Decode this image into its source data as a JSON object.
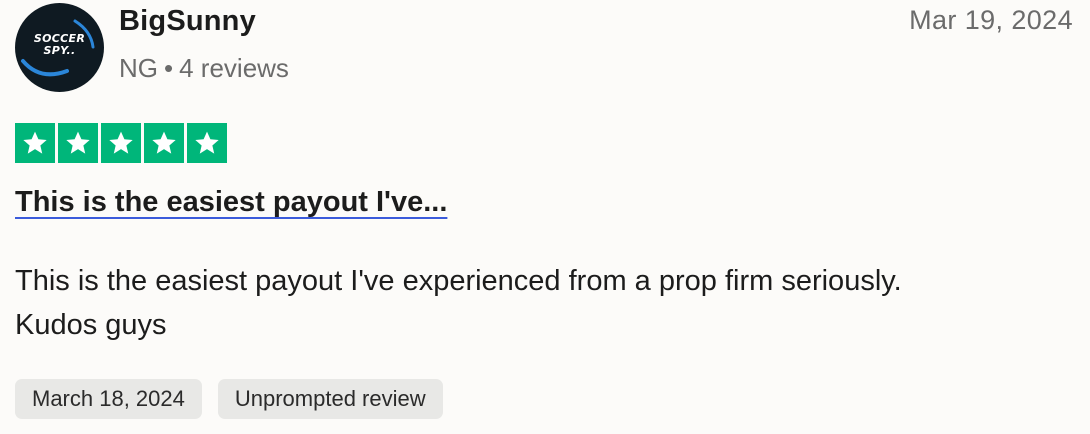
{
  "reviewer": {
    "avatar_text_line1": "SOCCER",
    "avatar_text_line2": "SPY..",
    "name": "BigSunny",
    "country": "NG",
    "separator": "•",
    "review_count": "4 reviews"
  },
  "review": {
    "posted_date": "Mar 19, 2024",
    "rating": 5,
    "rating_max": 5,
    "star_color": "#00b67a",
    "title": "This is the easiest payout I've...",
    "body_line1": "This is the easiest payout I've experienced from a prop firm seriously.",
    "body_line2": "Kudos guys"
  },
  "tags": {
    "experience_date": "March 18, 2024",
    "review_type": "Unprompted review"
  }
}
